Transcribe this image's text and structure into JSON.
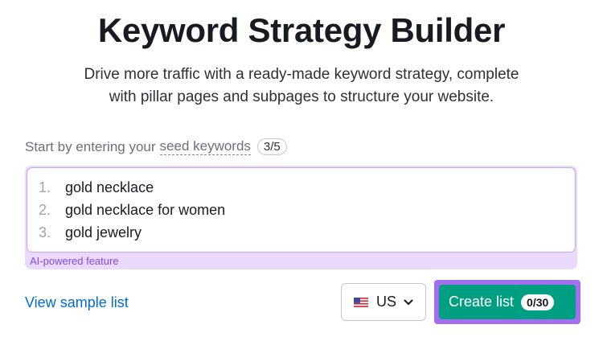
{
  "header": {
    "title": "Keyword Strategy Builder",
    "subtitle_line1": "Drive more traffic with a ready-made keyword strategy, complete",
    "subtitle_line2": "with pillar pages and subpages to structure your website."
  },
  "seed": {
    "label_prefix": "Start by entering your",
    "label_link": "seed keywords",
    "count": "3/5"
  },
  "keywords": {
    "items": [
      {
        "num": "1.",
        "text": "gold necklace"
      },
      {
        "num": "2.",
        "text": "gold necklace for women"
      },
      {
        "num": "3.",
        "text": "gold jewelry"
      }
    ],
    "ai_label": "AI-powered feature"
  },
  "actions": {
    "sample_link": "View sample list",
    "country": "US",
    "country_icon": "us-flag-icon",
    "create_label": "Create list",
    "create_count": "0/30"
  },
  "colors": {
    "accent_purple": "#a46ef0",
    "create_green": "#009f81",
    "link_blue": "#006dca",
    "ai_purple": "#8649e1"
  }
}
